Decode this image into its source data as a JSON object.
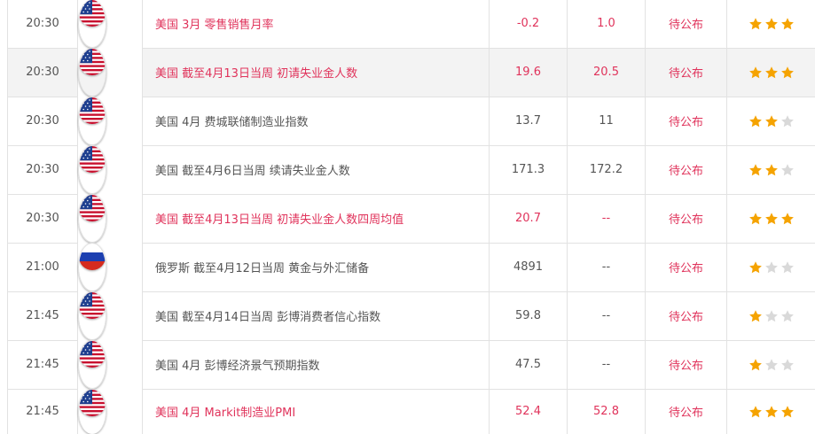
{
  "colors": {
    "important": "#e0335b",
    "star_on": "#f5a300",
    "star_off": "#d9d9d9",
    "row_highlight": "#f3f3f3"
  },
  "rows": [
    {
      "time": "20:30",
      "flag": "us-flag-icon",
      "event": "美国 3月 零售销售月率",
      "prior": "-0.2",
      "forecast": "1.0",
      "actual": "待公布",
      "stars": 3,
      "important": true,
      "highlight": false
    },
    {
      "time": "20:30",
      "flag": "us-flag-icon",
      "event": "美国 截至4月13日当周 初请失业金人数",
      "prior": "19.6",
      "forecast": "20.5",
      "actual": "待公布",
      "stars": 3,
      "important": true,
      "highlight": true
    },
    {
      "time": "20:30",
      "flag": "us-flag-icon",
      "event": "美国 4月 费城联储制造业指数",
      "prior": "13.7",
      "forecast": "11",
      "actual": "待公布",
      "stars": 2,
      "important": false,
      "highlight": false
    },
    {
      "time": "20:30",
      "flag": "us-flag-icon",
      "event": "美国 截至4月6日当周 续请失业金人数",
      "prior": "171.3",
      "forecast": "172.2",
      "actual": "待公布",
      "stars": 2,
      "important": false,
      "highlight": false
    },
    {
      "time": "20:30",
      "flag": "us-flag-icon",
      "event": "美国 截至4月13日当周 初请失业金人数四周均值",
      "prior": "20.7",
      "forecast": "--",
      "actual": "待公布",
      "stars": 3,
      "important": true,
      "highlight": false
    },
    {
      "time": "21:00",
      "flag": "russia-flag-icon",
      "event": "俄罗斯 截至4月12日当周 黄金与外汇储备",
      "prior": "4891",
      "forecast": "--",
      "actual": "待公布",
      "stars": 1,
      "important": false,
      "highlight": false
    },
    {
      "time": "21:45",
      "flag": "us-flag-icon",
      "event": "美国 截至4月14日当周 彭博消费者信心指数",
      "prior": "59.8",
      "forecast": "--",
      "actual": "待公布",
      "stars": 1,
      "important": false,
      "highlight": false
    },
    {
      "time": "21:45",
      "flag": "us-flag-icon",
      "event": "美国 4月 彭博经济景气预期指数",
      "prior": "47.5",
      "forecast": "--",
      "actual": "待公布",
      "stars": 1,
      "important": false,
      "highlight": false
    },
    {
      "time": "21:45",
      "flag": "us-flag-icon",
      "event": "美国 4月 Markit制造业PMI",
      "prior": "52.4",
      "forecast": "52.8",
      "actual": "待公布",
      "stars": 3,
      "important": true,
      "highlight": false
    }
  ]
}
